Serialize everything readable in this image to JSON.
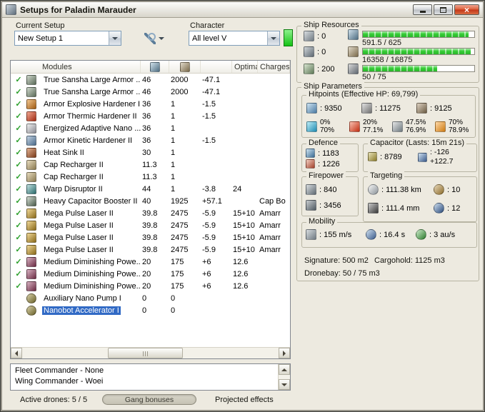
{
  "window": {
    "title": "Setups for Paladin Marauder",
    "close_glyph": "×"
  },
  "colors": {
    "selection": "#316ac5",
    "check_green": "#2ca02c",
    "progress_green": "#35cd35",
    "valid_indicator_green": "#15c215",
    "close_button_red": "#c23518",
    "window_background": "#EDEAE0"
  },
  "toolbar": {
    "current_setup_label": "Current Setup",
    "current_setup_value": "New Setup 1",
    "character_label": "Character",
    "character_value": "All level V"
  },
  "modules_table": {
    "header": {
      "modules": "Modules",
      "optimal": "Optimal",
      "charges": "Charges"
    },
    "check_glyph": "✓",
    "rows": [
      {
        "checked": true,
        "selected": false,
        "icon": "armor-repairer-icon",
        "name": "True Sansha Large Armor ...",
        "cpu": "46",
        "pg": "2000",
        "cap": "-47.1",
        "optimal": "",
        "charge": ""
      },
      {
        "checked": true,
        "selected": false,
        "icon": "armor-repairer-icon",
        "name": "True Sansha Large Armor ...",
        "cpu": "46",
        "pg": "2000",
        "cap": "-47.1",
        "optimal": "",
        "charge": ""
      },
      {
        "checked": true,
        "selected": false,
        "icon": "explosive-hardener-icon",
        "name": "Armor Explosive Hardener II",
        "cpu": "36",
        "pg": "1",
        "cap": "-1.5",
        "optimal": "",
        "charge": ""
      },
      {
        "checked": true,
        "selected": false,
        "icon": "thermic-hardener-icon",
        "name": "Armor Thermic Hardener II",
        "cpu": "36",
        "pg": "1",
        "cap": "-1.5",
        "optimal": "",
        "charge": ""
      },
      {
        "checked": true,
        "selected": false,
        "icon": "adaptive-membrane-icon",
        "name": "Energized Adaptive Nano ...",
        "cpu": "36",
        "pg": "1",
        "cap": "",
        "optimal": "",
        "charge": ""
      },
      {
        "checked": true,
        "selected": false,
        "icon": "kinetic-hardener-icon",
        "name": "Armor Kinetic Hardener II",
        "cpu": "36",
        "pg": "1",
        "cap": "-1.5",
        "optimal": "",
        "charge": ""
      },
      {
        "checked": true,
        "selected": false,
        "icon": "heat-sink-icon",
        "name": "Heat Sink II",
        "cpu": "30",
        "pg": "1",
        "cap": "",
        "optimal": "",
        "charge": ""
      },
      {
        "checked": true,
        "selected": false,
        "icon": "cap-recharger-icon",
        "name": "Cap Recharger II",
        "cpu": "11.3",
        "pg": "1",
        "cap": "",
        "optimal": "",
        "charge": ""
      },
      {
        "checked": true,
        "selected": false,
        "icon": "cap-recharger-icon",
        "name": "Cap Recharger II",
        "cpu": "11.3",
        "pg": "1",
        "cap": "",
        "optimal": "",
        "charge": ""
      },
      {
        "checked": true,
        "selected": false,
        "icon": "warp-disruptor-icon",
        "name": "Warp Disruptor II",
        "cpu": "44",
        "pg": "1",
        "cap": "-3.8",
        "optimal": "24",
        "charge": ""
      },
      {
        "checked": true,
        "selected": false,
        "icon": "cap-booster-icon",
        "name": "Heavy Capacitor Booster II",
        "cpu": "40",
        "pg": "1925",
        "cap": "+57.1",
        "optimal": "",
        "charge": "Cap Bo"
      },
      {
        "checked": true,
        "selected": false,
        "icon": "pulse-laser-icon",
        "name": "Mega Pulse Laser II",
        "cpu": "39.8",
        "pg": "2475",
        "cap": "-5.9",
        "optimal": "15+10",
        "charge": "Amarr"
      },
      {
        "checked": true,
        "selected": false,
        "icon": "pulse-laser-icon",
        "name": "Mega Pulse Laser II",
        "cpu": "39.8",
        "pg": "2475",
        "cap": "-5.9",
        "optimal": "15+10",
        "charge": "Amarr"
      },
      {
        "checked": true,
        "selected": false,
        "icon": "pulse-laser-icon",
        "name": "Mega Pulse Laser II",
        "cpu": "39.8",
        "pg": "2475",
        "cap": "-5.9",
        "optimal": "15+10",
        "charge": "Amarr"
      },
      {
        "checked": true,
        "selected": false,
        "icon": "pulse-laser-icon",
        "name": "Mega Pulse Laser II",
        "cpu": "39.8",
        "pg": "2475",
        "cap": "-5.9",
        "optimal": "15+10",
        "charge": "Amarr"
      },
      {
        "checked": true,
        "selected": false,
        "icon": "nosferatu-icon",
        "name": "Medium Diminishing Powe...",
        "cpu": "20",
        "pg": "175",
        "cap": "+6",
        "optimal": "12.6",
        "charge": ""
      },
      {
        "checked": true,
        "selected": false,
        "icon": "nosferatu-icon",
        "name": "Medium Diminishing Powe...",
        "cpu": "20",
        "pg": "175",
        "cap": "+6",
        "optimal": "12.6",
        "charge": ""
      },
      {
        "checked": true,
        "selected": false,
        "icon": "nosferatu-icon",
        "name": "Medium Diminishing Powe...",
        "cpu": "20",
        "pg": "175",
        "cap": "+6",
        "optimal": "12.6",
        "charge": ""
      },
      {
        "checked": false,
        "selected": false,
        "icon": "armor-rig-icon",
        "name": "Auxiliary Nano Pump I",
        "cpu": "0",
        "pg": "0",
        "cap": "",
        "optimal": "",
        "charge": ""
      },
      {
        "checked": false,
        "selected": true,
        "icon": "armor-rig-icon",
        "name": "Nanobot Accelerator I",
        "cpu": "0",
        "pg": "0",
        "cap": "",
        "optimal": "",
        "charge": ""
      }
    ]
  },
  "commander_list": {
    "items": [
      "Fleet Commander - None",
      "Wing Commander - Woei"
    ]
  },
  "status_bar": {
    "active_drones": "Active drones: 5 / 5",
    "gang_bonuses": "Gang bonuses",
    "projected_effects": "Projected effects"
  },
  "ship_resources": {
    "title": "Ship Resources",
    "turrets": ": 0",
    "launchers": ": 0",
    "calibration": ": 200",
    "cpu": {
      "label": "591.5 / 625",
      "pct": 94.6
    },
    "powergrid": {
      "label": "16358 / 16875",
      "pct": 96.9
    },
    "dronebay": {
      "label": "50 / 75",
      "pct": 66.7
    }
  },
  "ship_parameters": {
    "title": "Ship Parameters",
    "hitpoints": {
      "title": "Hitpoints (Effective HP: 69,799)",
      "shield": ": 9350",
      "armor": ": 11275",
      "hull": ": 9125",
      "resists": [
        {
          "shield": "0%",
          "armor": "70%"
        },
        {
          "shield": "20%",
          "armor": "77.1%"
        },
        {
          "shield": "47.5%",
          "armor": "76.9%"
        },
        {
          "shield": "70%",
          "armor": "78.9%"
        }
      ]
    },
    "defence": {
      "title": "Defence",
      "shield_recharge": ": 1183",
      "armor_repair": ": 1226"
    },
    "capacitor": {
      "title": "Capacitor (Lasts: 15m 21s)",
      "capacity": ": 8789",
      "drain": ": -126",
      "recharge": "+122.7"
    },
    "firepower": {
      "title": "Firepower",
      "dps": ": 840",
      "volley": ": 3456"
    },
    "targeting": {
      "title": "Targeting",
      "range": ": 111.38 km",
      "max_targets": ": 10",
      "scan_resolution": ": 111.4 mm",
      "sensor_strength": ": 12"
    },
    "mobility": {
      "title": "Mobility",
      "speed": ": 155 m/s",
      "align_time": ": 16.4 s",
      "warp_speed": ": 3 au/s"
    },
    "signature": "Signature: 500 m2",
    "cargohold": "Cargohold: 1125 m3",
    "dronebay": "Dronebay: 50 / 75 m3"
  },
  "icons": {
    "app-icon": {
      "hi": "#cdd6de",
      "lo": "#5f6e7c"
    },
    "wrench-icon": {
      "hi": "#8fb0c8",
      "lo": "#4a6a84"
    },
    "cpu-icon": {
      "hi": "#cfe0ea",
      "lo": "#4f6e82"
    },
    "powergrid-icon": {
      "hi": "#e0d8c8",
      "lo": "#7a6a4a"
    },
    "turret-hardpoint-icon": {
      "hi": "#d9dde0",
      "lo": "#6f7a82"
    },
    "launcher-hardpoint-icon": {
      "hi": "#cfd4d8",
      "lo": "#5f6a72"
    },
    "calibration-icon": {
      "hi": "#d8e4d0",
      "lo": "#5f7a58"
    },
    "dronebay-icon": {
      "hi": "#d8d8d8",
      "lo": "#606870"
    },
    "shield-hp-icon": {
      "hi": "#cfe4f2",
      "lo": "#4a7aa2"
    },
    "armor-hp-icon": {
      "hi": "#e2e2e2",
      "lo": "#707070"
    },
    "hull-hp-icon": {
      "hi": "#ded2c2",
      "lo": "#6a5a42"
    },
    "em-resist-icon": {
      "hi": "#bfeef8",
      "lo": "#1e8ab0"
    },
    "thermal-resist-icon": {
      "hi": "#f8c0b0",
      "lo": "#c22e12"
    },
    "kinetic-resist-icon": {
      "hi": "#e6e6e6",
      "lo": "#6e7a80"
    },
    "explosive-resist-icon": {
      "hi": "#ffd9a8",
      "lo": "#cc7a12"
    },
    "shield-recharge-icon": {
      "hi": "#cfe4f2",
      "lo": "#3a6a92"
    },
    "armor-repair-icon": {
      "hi": "#f2cfc2",
      "lo": "#a2402a"
    },
    "capacitor-icon": {
      "hi": "#e8e2b8",
      "lo": "#8a7a2a"
    },
    "cap-recharge-icon": {
      "hi": "#cfe0f0",
      "lo": "#3a5a8a"
    },
    "turret-dps-icon": {
      "hi": "#d9dde0",
      "lo": "#5f6a72"
    },
    "volley-icon": {
      "hi": "#c9cdd0",
      "lo": "#4f5a62"
    },
    "targeting-range-icon": {
      "hi": "#f6f6f6",
      "lo": "#8a9298",
      "round": true
    },
    "max-targets-icon": {
      "hi": "#e8d8b8",
      "lo": "#8a6a2a",
      "round": true
    },
    "scan-resolution-icon": {
      "hi": "#c8c8c8",
      "lo": "#3a3a3a"
    },
    "sensor-strength-icon": {
      "hi": "#cfe0f0",
      "lo": "#2a4a7a",
      "round": true
    },
    "velocity-icon": {
      "hi": "#d9dde0",
      "lo": "#6f7a82"
    },
    "align-time-icon": {
      "hi": "#cfe0f0",
      "lo": "#3a5a8a",
      "round": true
    },
    "warp-speed-icon": {
      "hi": "#cfeccc",
      "lo": "#2a7a2a",
      "round": true
    },
    "armor-repairer-icon": {
      "hi": "#cfd8cc",
      "lo": "#5a6a58"
    },
    "explosive-hardener-icon": {
      "hi": "#f2c892",
      "lo": "#a05a12"
    },
    "thermic-hardener-icon": {
      "hi": "#f2a892",
      "lo": "#a02a12"
    },
    "adaptive-membrane-icon": {
      "hi": "#f0f0f0",
      "lo": "#8a8a92"
    },
    "kinetic-hardener-icon": {
      "hi": "#c2d2e2",
      "lo": "#4a6a8a"
    },
    "heat-sink-icon": {
      "hi": "#e2b292",
      "lo": "#7a3a1a"
    },
    "cap-recharger-icon": {
      "hi": "#e8dcc0",
      "lo": "#8a7a50"
    },
    "warp-disruptor-icon": {
      "hi": "#c2e2e2",
      "lo": "#2a6a6a"
    },
    "cap-booster-icon": {
      "hi": "#d2dcd2",
      "lo": "#4a5a4a"
    },
    "pulse-laser-icon": {
      "hi": "#f0d898",
      "lo": "#8a6a1a"
    },
    "nosferatu-icon": {
      "hi": "#d8b2c2",
      "lo": "#6a2a42"
    },
    "armor-rig-icon": {
      "hi": "#d8d0a8",
      "lo": "#6a622a",
      "round": true
    }
  }
}
